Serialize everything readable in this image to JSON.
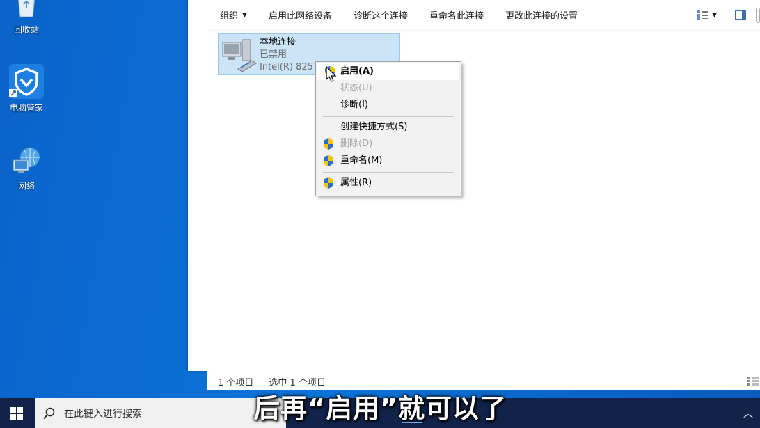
{
  "desktop": {
    "icons": [
      {
        "label": "回收站"
      },
      {
        "label": "电脑管家"
      },
      {
        "label": "网络"
      }
    ]
  },
  "toolbar": {
    "items": [
      {
        "label": "组织"
      },
      {
        "label": "启用此网络设备"
      },
      {
        "label": "诊断这个连接"
      },
      {
        "label": "重命名此连接"
      },
      {
        "label": "更改此连接的设置"
      }
    ]
  },
  "connection": {
    "name": "本地连接",
    "status": "已禁用",
    "adapter": "Intel(R) 82574"
  },
  "context_menu": {
    "items": [
      {
        "label": "启用(A)"
      },
      {
        "label": "状态(U)"
      },
      {
        "label": "诊断(I)"
      },
      {
        "label": "创建快捷方式(S)"
      },
      {
        "label": "删除(D)"
      },
      {
        "label": "重命名(M)"
      },
      {
        "label": "属性(R)"
      }
    ]
  },
  "statusbar": {
    "count": "1 个项目",
    "selected": "选中 1 个项目"
  },
  "taskbar": {
    "search_placeholder": "在此键入进行搜索"
  },
  "subtitle": "后再“启用”就可以了",
  "colors": {
    "desktop_blue": "#0b74d8",
    "selection": "#cce4f7",
    "shield_blue": "#2a6fcf",
    "shield_yellow": "#f5c400",
    "taskbar": "#12234a"
  }
}
